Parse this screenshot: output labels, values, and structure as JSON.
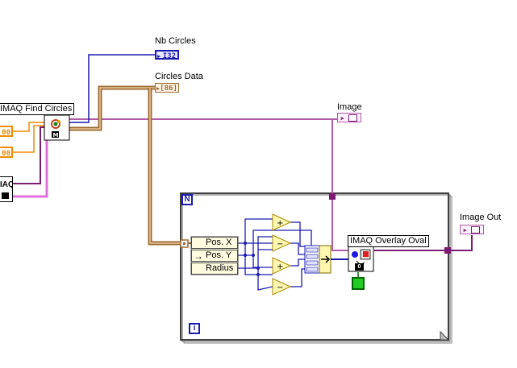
{
  "diagram": {
    "labels": {
      "nb_circles": "Nb Circles",
      "circles_data": "Circles Data",
      "image": "Image",
      "image_out": "Image Out"
    },
    "nodes": {
      "find_circles": "IMAQ Find Circles",
      "overlay_oval": "IMAQ Overlay Oval"
    },
    "indicators": {
      "nb_circles_type": "I32",
      "circles_data_type": "[86]"
    },
    "left_controls": [
      "00",
      "00"
    ],
    "left_node_partial": "IAQ",
    "unbundle_fields": [
      "Pos. X",
      "Pos. Y",
      "Radius"
    ],
    "for_loop": {
      "count_terminal": "N",
      "iteration_terminal": "i"
    },
    "overlay_index_constant": "0",
    "colors": {
      "image_wire": "#b05aa8",
      "image_wire_dark": "#7a1e72",
      "int_wire": "#1a1ab0",
      "cluster_wire": "#9c6b30",
      "cluster_wire_light": "#e8c89a",
      "control_orange": "#f08c00",
      "loop_tunnel": "#7a1a72",
      "green_constant": "#22cc22",
      "primitive_fill": "#fff6b0",
      "primitive_border": "#a88a00"
    }
  }
}
